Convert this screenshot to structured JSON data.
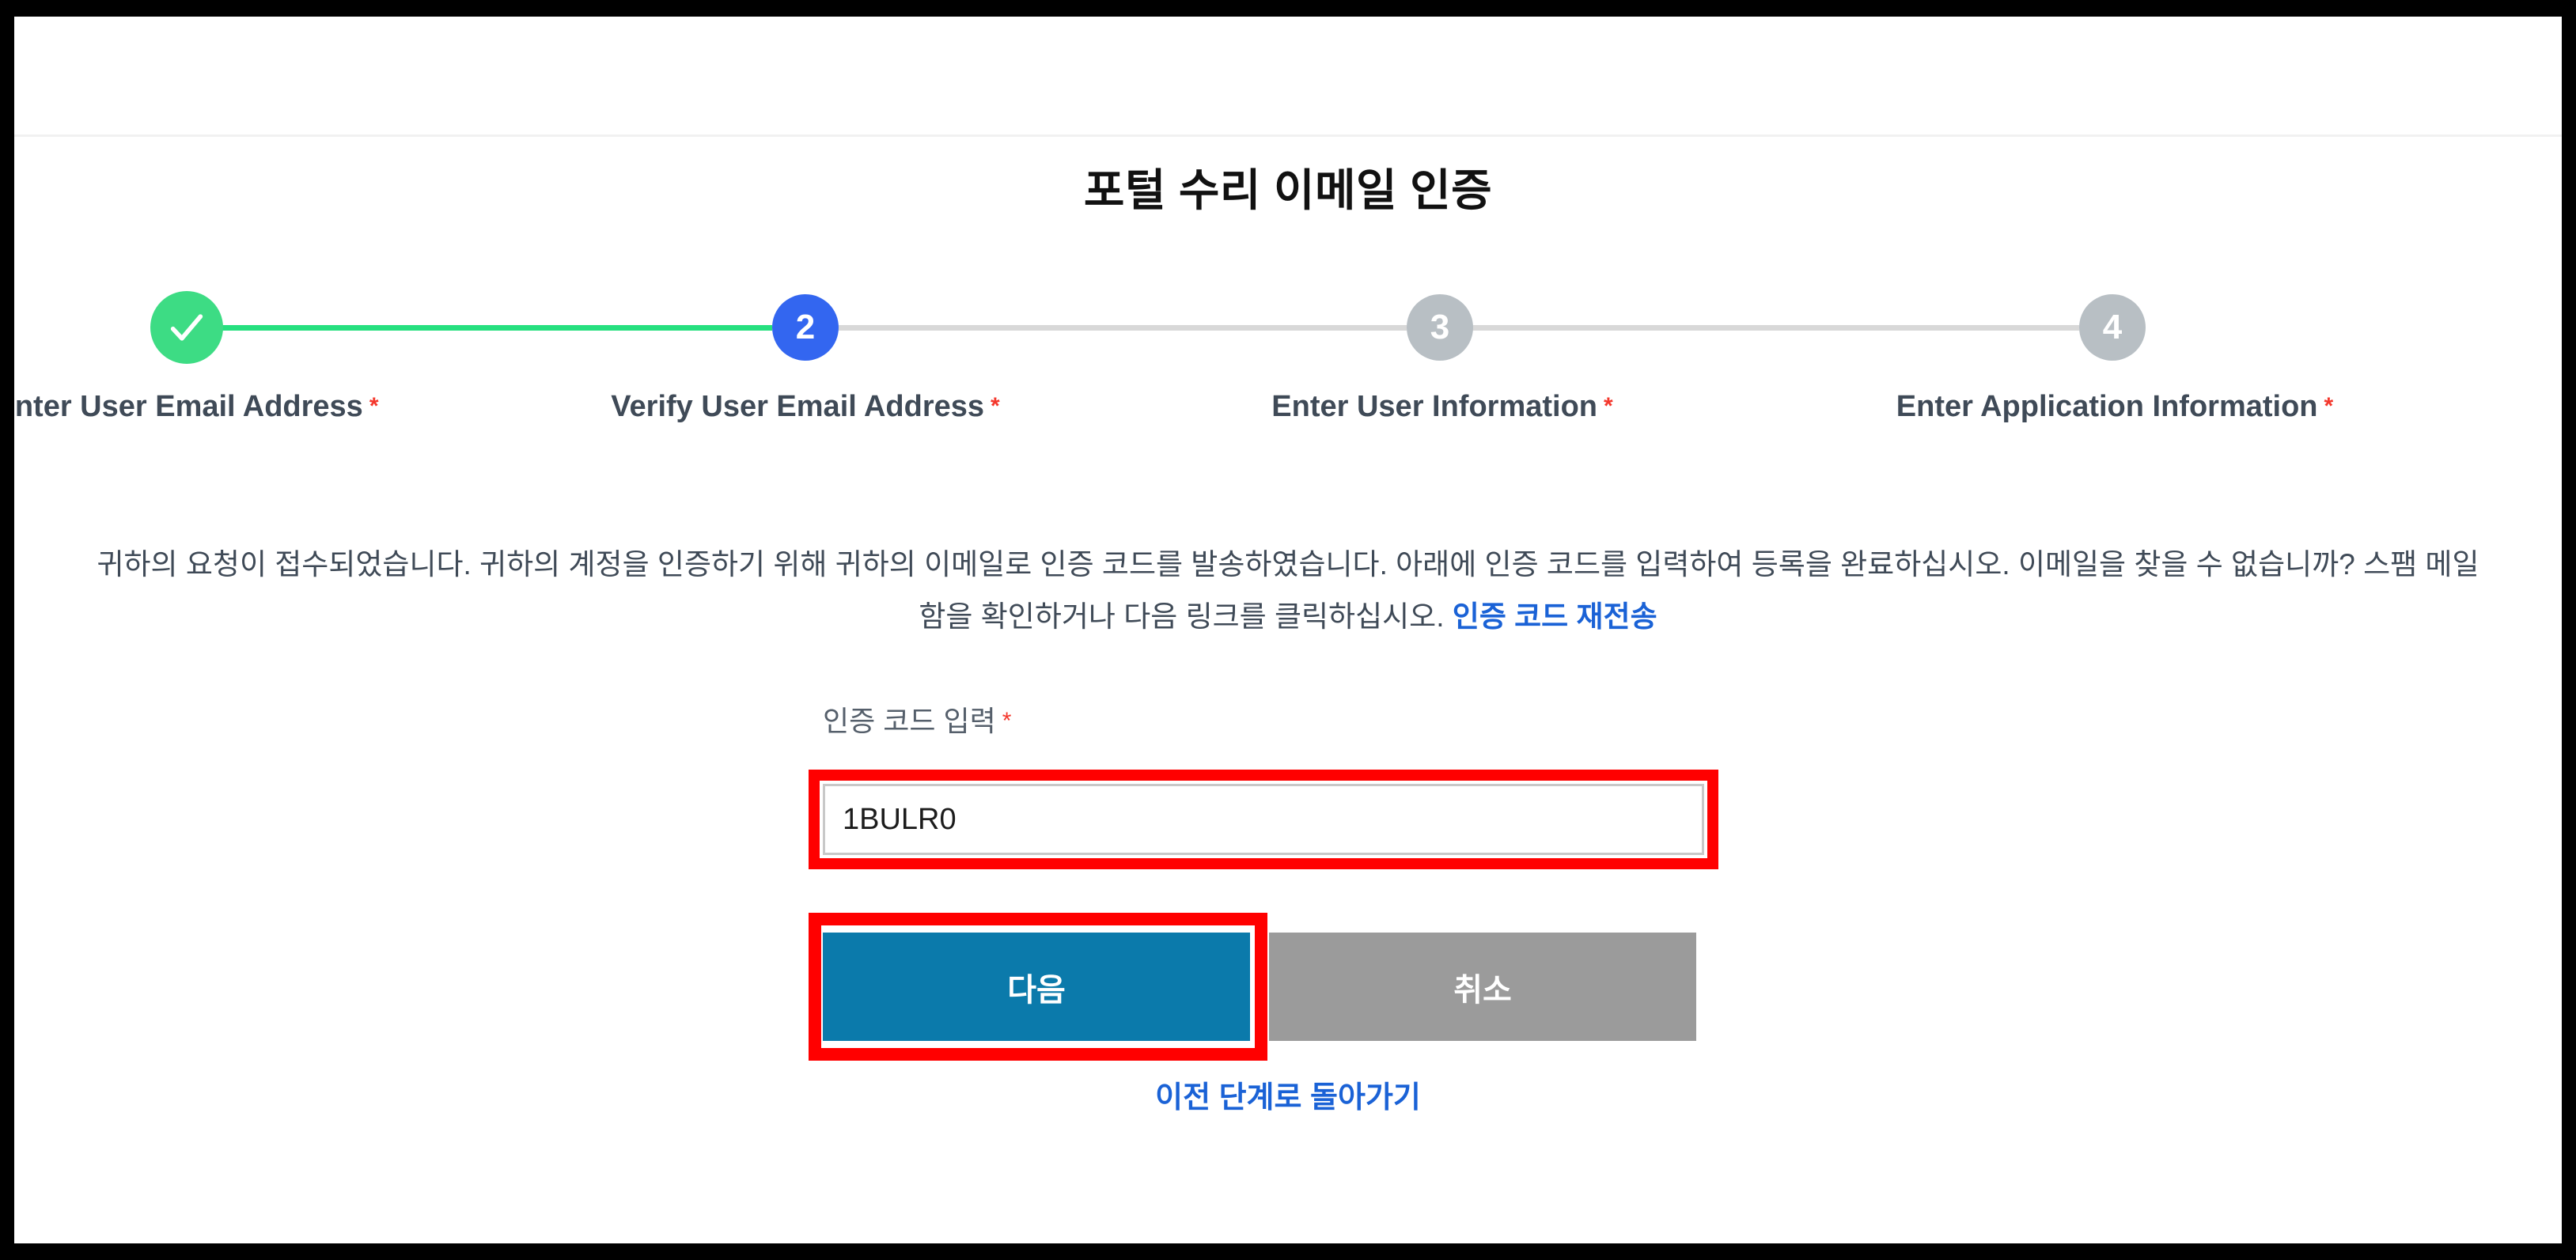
{
  "page": {
    "title": "포털 수리 이메일 인증"
  },
  "stepper": {
    "steps": [
      {
        "number": "✓",
        "label": "Enter User Email Address",
        "required_mark": "*",
        "state": "done"
      },
      {
        "number": "2",
        "label": "Verify User Email Address",
        "required_mark": "*",
        "state": "current"
      },
      {
        "number": "3",
        "label": "Enter User Information",
        "required_mark": "*",
        "state": "todo"
      },
      {
        "number": "4",
        "label": "Enter Application Information",
        "required_mark": "*",
        "state": "todo"
      }
    ],
    "colors": {
      "done": "#3ddc84",
      "current": "#3366f0",
      "todo": "#b8bfc4",
      "line_done": "#26e07f",
      "line_todo": "#d8d8d8"
    }
  },
  "instructions": {
    "text_before_link": "귀하의 요청이 접수되었습니다. 귀하의 계정을 인증하기 위해 귀하의 이메일로 인증 코드를 발송하였습니다. 아래에 인증 코드를 입력하여 등록을 완료하십시오. 이메일을 찾을 수 없습니까? 스팸 메일함을 확인하거나 다음 링크를 클릭하십시오.",
    "resend_link": "인증 코드 재전송"
  },
  "form": {
    "code_label": "인증 코드 입력",
    "code_required_mark": "*",
    "code_value": "1BULR0",
    "code_placeholder": ""
  },
  "buttons": {
    "next": "다음",
    "cancel": "취소",
    "next_color": "#0b7aab",
    "cancel_color": "#9b9b9b"
  },
  "footer": {
    "back_link": "이전 단계로 돌아가기"
  },
  "annotations": {
    "highlight_color": "#ff0000"
  }
}
